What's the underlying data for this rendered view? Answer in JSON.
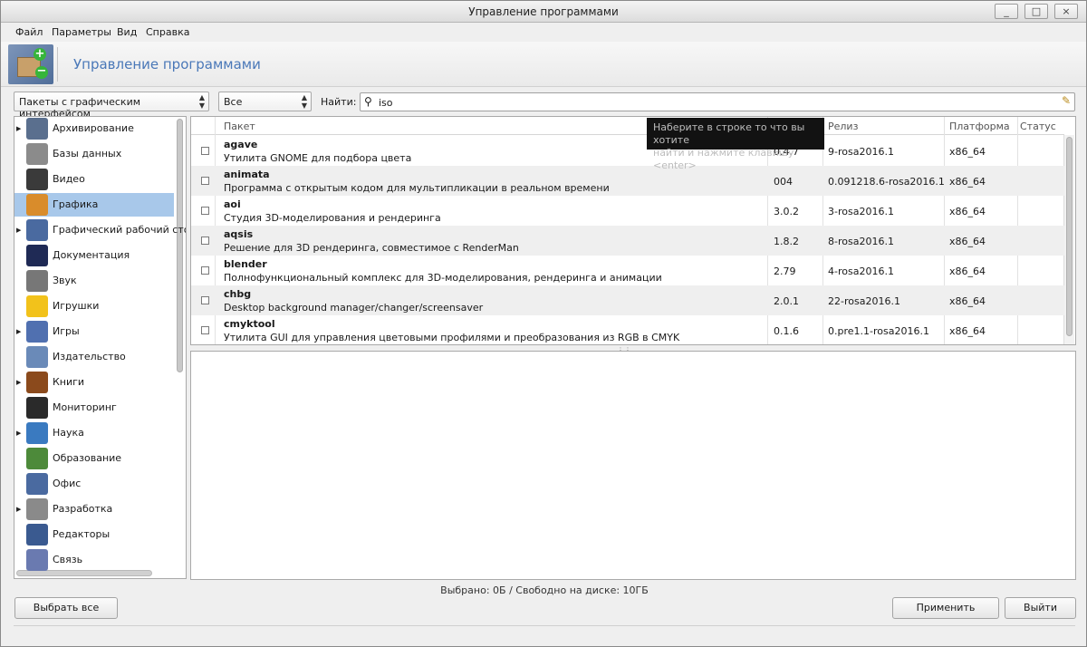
{
  "window": {
    "title": "Управление программами",
    "btn_min": "_",
    "btn_max": "□",
    "btn_close": "×"
  },
  "menu": {
    "file": "Файл",
    "params": "Параметры",
    "view": "Вид",
    "help": "Справка"
  },
  "header": {
    "title": "Управление программами"
  },
  "filters": {
    "type_value": "Пакеты с графическим интерфейсом",
    "state_value": "Все",
    "search_label": "Найти:",
    "search_value": "iso"
  },
  "categories": [
    {
      "label": "Архивирование",
      "expandable": true,
      "icon": "archive-icon",
      "color": "#5a6f8e"
    },
    {
      "label": "Базы данных",
      "expandable": false,
      "icon": "database-icon",
      "color": "#8b8b8b"
    },
    {
      "label": "Видео",
      "expandable": false,
      "icon": "film-icon",
      "color": "#3a3a3a"
    },
    {
      "label": "Графика",
      "expandable": false,
      "icon": "palette-icon",
      "color": "#d98c2b",
      "selected": true
    },
    {
      "label": "Графический рабочий стол",
      "expandable": true,
      "icon": "desktop-icon",
      "color": "#4a6aa0"
    },
    {
      "label": "Документация",
      "expandable": false,
      "icon": "star-doc-icon",
      "color": "#1f2a55"
    },
    {
      "label": "Звук",
      "expandable": false,
      "icon": "speaker-icon",
      "color": "#777777"
    },
    {
      "label": "Игрушки",
      "expandable": false,
      "icon": "smiley-icon",
      "color": "#f2c21b"
    },
    {
      "label": "Игры",
      "expandable": true,
      "icon": "gamepad-icon",
      "color": "#5070b0"
    },
    {
      "label": "Издательство",
      "expandable": false,
      "icon": "publishing-icon",
      "color": "#6a8ab8"
    },
    {
      "label": "Книги",
      "expandable": true,
      "icon": "book-icon",
      "color": "#8b4a1c"
    },
    {
      "label": "Мониторинг",
      "expandable": false,
      "icon": "monitor-icon",
      "color": "#2a2a2a"
    },
    {
      "label": "Наука",
      "expandable": true,
      "icon": "science-icon",
      "color": "#3a7ac0"
    },
    {
      "label": "Образование",
      "expandable": false,
      "icon": "blackboard-icon",
      "color": "#4d8a3a"
    },
    {
      "label": "Офис",
      "expandable": false,
      "icon": "office-icon",
      "color": "#4a6aa0"
    },
    {
      "label": "Разработка",
      "expandable": true,
      "icon": "tools-icon",
      "color": "#8a8a8a"
    },
    {
      "label": "Редакторы",
      "expandable": false,
      "icon": "editor-icon",
      "color": "#3a5a90"
    },
    {
      "label": "Связь",
      "expandable": false,
      "icon": "network-icon",
      "color": "#6a7ab0"
    }
  ],
  "table": {
    "headers": {
      "package": "Пакет",
      "release": "Релиз",
      "platform": "Платформа",
      "status": "Статус"
    },
    "rows": [
      {
        "name": "agave",
        "desc": "Утилита GNOME для подбора цвета",
        "version": "0.4.7",
        "release": "9-rosa2016.1",
        "platform": "x86_64"
      },
      {
        "name": "animata",
        "desc": "Программа с открытым кодом для мультипликации в реальном времени",
        "version": "004",
        "release": "0.091218.6-rosa2016.1",
        "platform": "x86_64"
      },
      {
        "name": "aoi",
        "desc": "Студия 3D-моделирования и рендеринга",
        "version": "3.0.2",
        "release": "3-rosa2016.1",
        "platform": "x86_64"
      },
      {
        "name": "aqsis",
        "desc": "Решение для 3D рендеринга, совместимое с RenderMan",
        "version": "1.8.2",
        "release": "8-rosa2016.1",
        "platform": "x86_64"
      },
      {
        "name": "blender",
        "desc": "Полнофункциональный комплекс для 3D-моделирования, рендеринга и анимации",
        "version": "2.79",
        "release": "4-rosa2016.1",
        "platform": "x86_64"
      },
      {
        "name": "chbg",
        "desc": "Desktop background manager/changer/screensaver",
        "version": "2.0.1",
        "release": "22-rosa2016.1",
        "platform": "x86_64"
      },
      {
        "name": "cmyktool",
        "desc": "Утилита GUI для управления цветовыми профилями и преобразования из RGB в CMYK",
        "version": "0.1.6",
        "release": "0.pre1.1-rosa2016.1",
        "platform": "x86_64"
      }
    ]
  },
  "tooltip": {
    "line1": "Наберите в строке то что вы хотите",
    "line2": "найти и нажмите клавишу <enter>"
  },
  "status_text": "Выбрано: 0Б / Свободно на диске: 10ГБ",
  "buttons": {
    "select_all": "Выбрать все",
    "apply": "Применить",
    "quit": "Выйти"
  }
}
